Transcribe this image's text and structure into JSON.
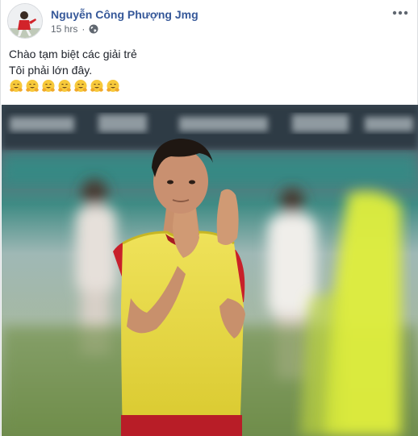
{
  "post": {
    "author": "Nguyễn Công Phượng Jmg",
    "time": "15 hrs",
    "privacy_icon": "globe-icon",
    "more_icon": "more-horizontal-icon",
    "text_lines": [
      "Chào tạm biệt các giải trẻ",
      "Tôi phải lớn đây."
    ],
    "emoji_icon": "hugging-face-emoji",
    "emoji_count": 7
  },
  "colors": {
    "author_link": "#365899",
    "meta_text": "#606770",
    "body_text": "#1d2129",
    "bib_yellow": "#e8d93a",
    "jersey_red": "#c8202a"
  }
}
